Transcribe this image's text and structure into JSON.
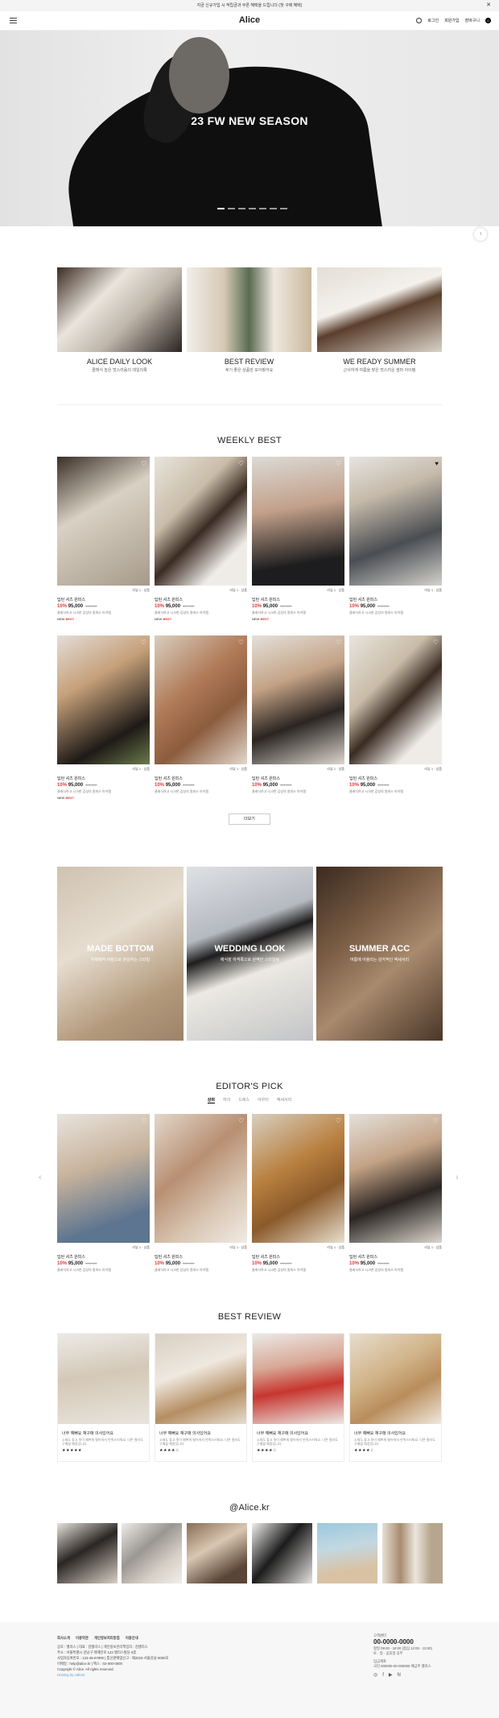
{
  "topbar": {
    "text": "지금 신규가입 시 적립금과 쿠폰 혜택을 드립니다 (첫 구매 혜택)",
    "close": "✕"
  },
  "header": {
    "logo": "Alice",
    "login": "로그인",
    "join": "회원가입",
    "cart": "장바구니",
    "cart_count": "0"
  },
  "hero": {
    "title": "23 FW NEW SEASON"
  },
  "top_button": "↑",
  "categories": [
    {
      "title": "ALICE DAILY LOOK",
      "sub": "클래식 높은 멋스러움의 데일리룩"
    },
    {
      "title": "BEST REVIEW",
      "sub": "후기 좋은 상품만 모아봤어요"
    },
    {
      "title": "WE READY SUMMER",
      "sub": "근사하게 여름을 맞은 멋스러운 썸머 아이템"
    }
  ],
  "weekly": {
    "title": "WEEKLY BEST",
    "meta": "리뷰 1 · 상품",
    "name": "딥턴 셔츠 원피스",
    "price": "95,000",
    "discount": "10%",
    "orig": "105,000",
    "desc": "클래식하고 시크한 감성의 원피스 아이템",
    "badge_new": "NEW",
    "badge_best": "BEST",
    "more": "더보기"
  },
  "banners": [
    {
      "title": "MADE BOTTOM",
      "sub": "자체제작 바텀으로 완성하는 스타일"
    },
    {
      "title": "WEDDING LOOK",
      "sub": "예식장 하객룩으로 완벽한 스타일링"
    },
    {
      "title": "SUMMER ACC",
      "sub": "여름에 어울리는 감각적인 액세서리"
    }
  ],
  "editors": {
    "title": "EDITOR'S PICK",
    "tabs": [
      "상의",
      "하의",
      "드레스",
      "아우터",
      "액세서리"
    ],
    "prev": "‹",
    "next": "›"
  },
  "reviews": {
    "title": "BEST REVIEW",
    "item_title": "너무 예뻐요 재구매 의사있어요",
    "item_body": "소재도 좋고 핏이 예쁘게 떨어져서 만족스러워요. 다른 컬러도 구매할 예정입니다.",
    "stars": [
      "★★★★★",
      "★★★★☆",
      "★★★★☆",
      "★★★★☆"
    ]
  },
  "instagram": {
    "title": "@Alice.kr"
  },
  "footer": {
    "links": [
      "회사소개",
      "이용약관",
      "개인정보처리방침",
      "이용안내"
    ],
    "company": "상호 : 앨리스 | 대표 : 김앨리스 | 개인정보관리책임자 : 김앨리스",
    "address": "주소 : 서울특별시 강남구 테헤란로 123 앨리스빌딩 5층",
    "biz": "사업자등록번호 : 123-45-67890 | 통신판매업신고 : 제2023-서울강남-0000호",
    "contact": "이메일 : help@alice.kr | 팩스 : 02-000-0000",
    "copyright": "Copyright © Alice. All rights reserved.",
    "hosting": "Hosting by cafe24",
    "cs_label": "고객센터",
    "phone": "00-0000-0000",
    "hours": "평일 09:00 - 18:00 (점심 12:00 - 13:00)",
    "weekend": "토 · 일 · 공휴일 휴무",
    "bank_label": "입금계좌",
    "bank": "국민 000000-00-000000 예금주 앨리스"
  }
}
